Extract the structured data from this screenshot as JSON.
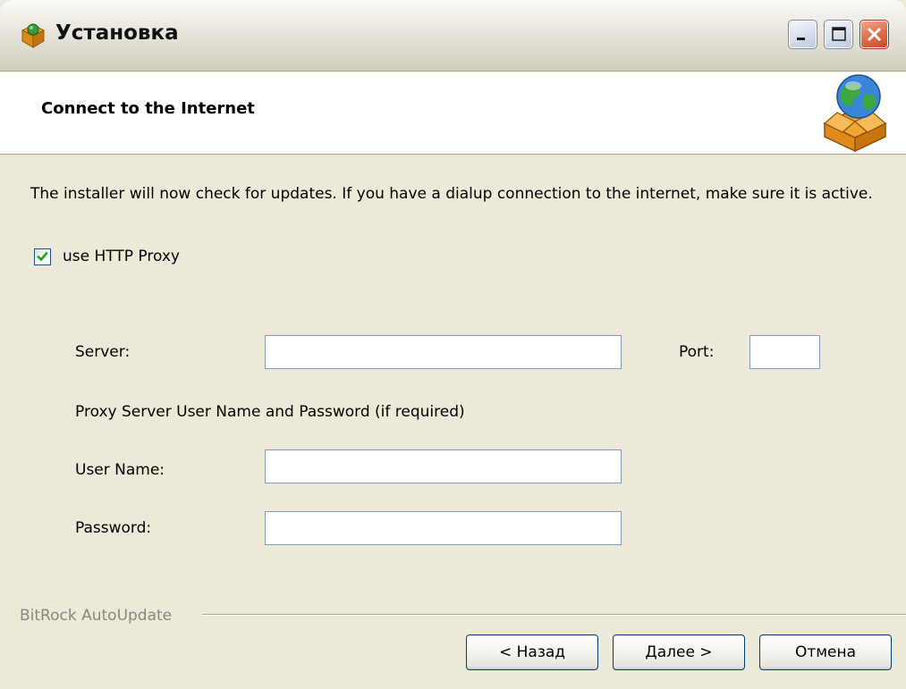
{
  "window": {
    "title": "Установка"
  },
  "header": {
    "title": "Connect to the Internet",
    "icon": "globe-box-icon"
  },
  "body": {
    "intro": "The installer will now check for updates. If you have a dialup connection to the internet, make sure it is active.",
    "use_proxy": {
      "label": "use HTTP Proxy",
      "checked": true
    },
    "server": {
      "label": "Server:",
      "value": ""
    },
    "port": {
      "label": "Port:",
      "value": ""
    },
    "credentials_note": "Proxy Server User Name and Password (if required)",
    "username": {
      "label": "User Name:",
      "value": ""
    },
    "password": {
      "label": "Password:",
      "value": ""
    }
  },
  "footer": {
    "brand": "BitRock AutoUpdate",
    "back_label": "< Назад",
    "next_label": "Далее >",
    "cancel_label": "Отмена"
  },
  "colors": {
    "dialog_bg": "#ece9d8",
    "header_bg": "#ffffff",
    "checkmark": "#21a121",
    "close_button": "#e06b46"
  }
}
